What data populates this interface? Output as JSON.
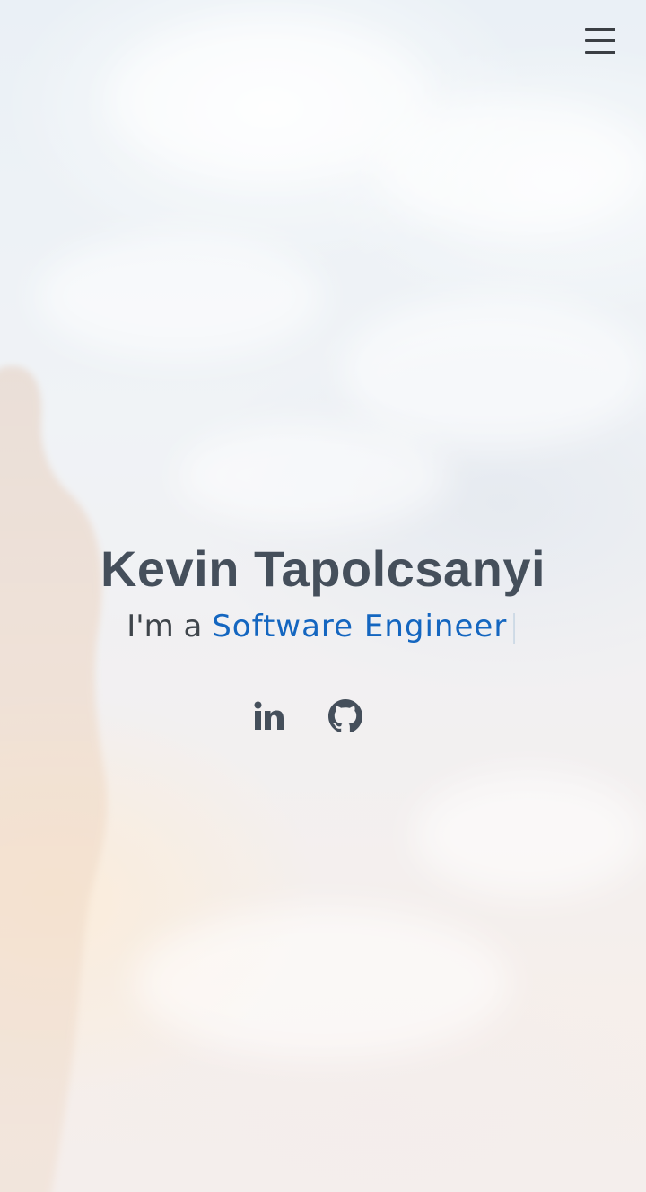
{
  "nav": {
    "menu_icon": "hamburger-menu-icon"
  },
  "hero": {
    "name": "Kevin Tapolcsanyi",
    "tagline_prefix": "I'm a",
    "tagline_typed": "Software Engineer",
    "cursor": "|",
    "accent_color": "#1466c0",
    "name_color": "#454f5b"
  },
  "socials": [
    {
      "icon": "linkedin-icon"
    },
    {
      "icon": "github-icon"
    }
  ]
}
